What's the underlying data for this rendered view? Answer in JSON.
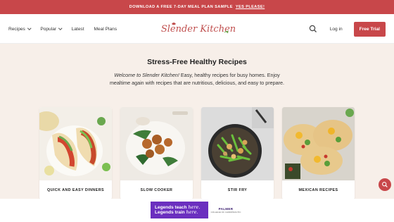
{
  "promo": {
    "text": "DOWNLOAD A FREE 7-DAY MEAL PLAN SAMPLE",
    "cta": "YES PLEASE!"
  },
  "nav": {
    "items": [
      {
        "label": "Recipes",
        "dropdown": true
      },
      {
        "label": "Popular",
        "dropdown": true
      },
      {
        "label": "Latest",
        "dropdown": false
      },
      {
        "label": "Meal Plans",
        "dropdown": false
      }
    ],
    "logo": "Slender Kitchen",
    "search_icon": "search-icon",
    "login": "Log in",
    "trial": "Free Trial"
  },
  "hero": {
    "title": "Stress-Free Healthy Recipes",
    "desc_em": "Welcome to Slender Kitchen!",
    "desc_rest": " Easy, healthy recipes for busy homes. Enjoy mealtime again with recipes that are nutritious, delicious, and easy to prepare."
  },
  "cards": [
    {
      "label": "QUICK AND EASY DINNERS",
      "image": "tacos"
    },
    {
      "label": "SLOW COOKER",
      "image": "meatballs"
    },
    {
      "label": "STIR FRY",
      "image": "stir-fry-pan"
    },
    {
      "label": "MEXICAN RECIPES",
      "image": "tostadas"
    }
  ],
  "ad": {
    "line1_a": "Legends teach ",
    "line1_b": "here.",
    "line2_a": "Legends train ",
    "line2_b": "here.",
    "brand": "PALMER",
    "brand_sub": "COLLEGE OF CHIROPRACTIC"
  },
  "colors": {
    "accent": "#c8474a",
    "background": "#f7efe9",
    "ad_purple": "#6b2fbf"
  }
}
